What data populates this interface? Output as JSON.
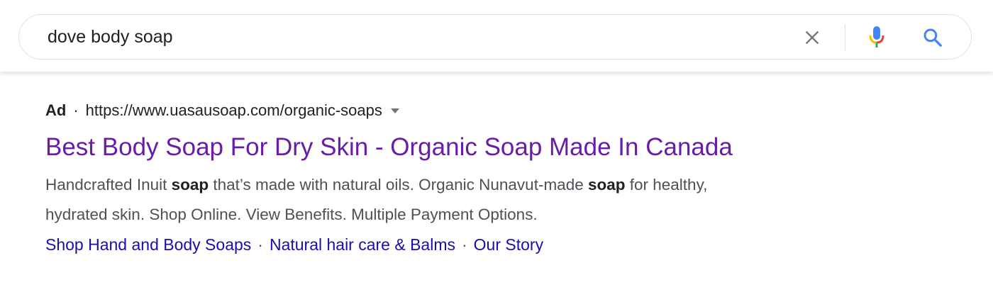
{
  "search": {
    "query": "dove body soap"
  },
  "result": {
    "ad_label": "Ad",
    "separator": "·",
    "url": "https://www.uasausoap.com/organic-soaps",
    "title": "Best Body Soap For Dry Skin - Organic Soap Made In Canada",
    "description": {
      "line1_part1": "Handcrafted Inuit ",
      "line1_bold1": "soap",
      "line1_part2": " that’s made with natural oils. Organic Nunavut-made ",
      "line1_bold2": "soap",
      "line1_part3": " for healthy,",
      "line2": "hydrated skin. Shop Online. View Benefits. Multiple Payment Options."
    },
    "sitelinks": [
      {
        "label": "Shop Hand and Body Soaps"
      },
      {
        "label": "Natural hair care & Balms"
      },
      {
        "label": "Our Story"
      }
    ],
    "sitelink_separator": "·"
  },
  "colors": {
    "title_visited": "#681da8",
    "sitelink": "#1a0dab",
    "text_secondary": "#4d5156",
    "search_blue": "#4285f4"
  },
  "icons": {
    "clear": "close-icon",
    "voice": "microphone-icon",
    "search": "search-icon",
    "url_menu": "caret-down-icon"
  }
}
